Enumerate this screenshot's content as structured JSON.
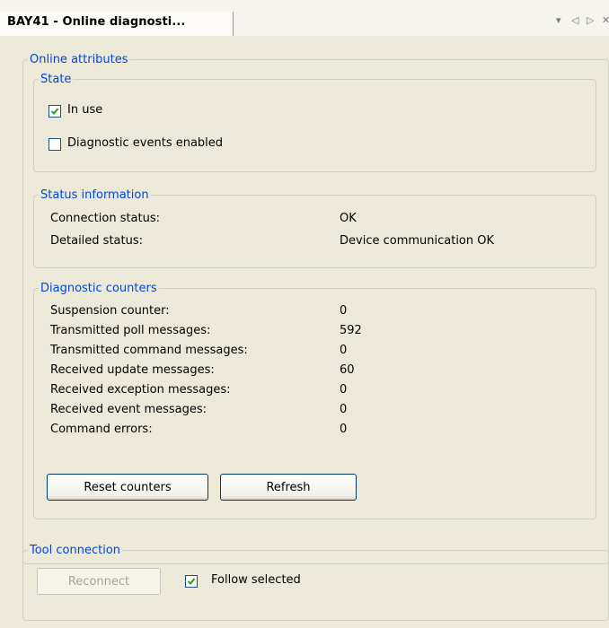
{
  "tab": {
    "title": "BAY41 - Online diagnosti..."
  },
  "online_attributes": {
    "legend": "Online attributes",
    "state": {
      "legend": "State",
      "in_use": {
        "label": "In use",
        "checked": true
      },
      "diag_events": {
        "label": "Diagnostic events enabled",
        "checked": false
      }
    },
    "status": {
      "legend": "Status information",
      "rows": [
        {
          "label": "Connection status:",
          "value": "OK"
        },
        {
          "label": "Detailed status:",
          "value": "Device communication OK"
        }
      ]
    },
    "counters": {
      "legend": "Diagnostic counters",
      "rows": [
        {
          "label": "Suspension counter:",
          "value": "0"
        },
        {
          "label": "Transmitted poll messages:",
          "value": "592"
        },
        {
          "label": "Transmitted command messages:",
          "value": "0"
        },
        {
          "label": "Received update messages:",
          "value": "60"
        },
        {
          "label": "Received exception messages:",
          "value": "0"
        },
        {
          "label": "Received event messages:",
          "value": "0"
        },
        {
          "label": "Command errors:",
          "value": "0"
        }
      ],
      "reset_label": "Reset counters",
      "refresh_label": "Refresh"
    }
  },
  "tool_connection": {
    "legend": "Tool connection",
    "reconnect_label": "Reconnect",
    "follow": {
      "label": "Follow selected",
      "checked": true
    }
  },
  "icons": {
    "dropdown": "dropdown-arrow-icon",
    "prev": "nav-left-icon",
    "next": "nav-right-icon",
    "close": "close-icon"
  }
}
